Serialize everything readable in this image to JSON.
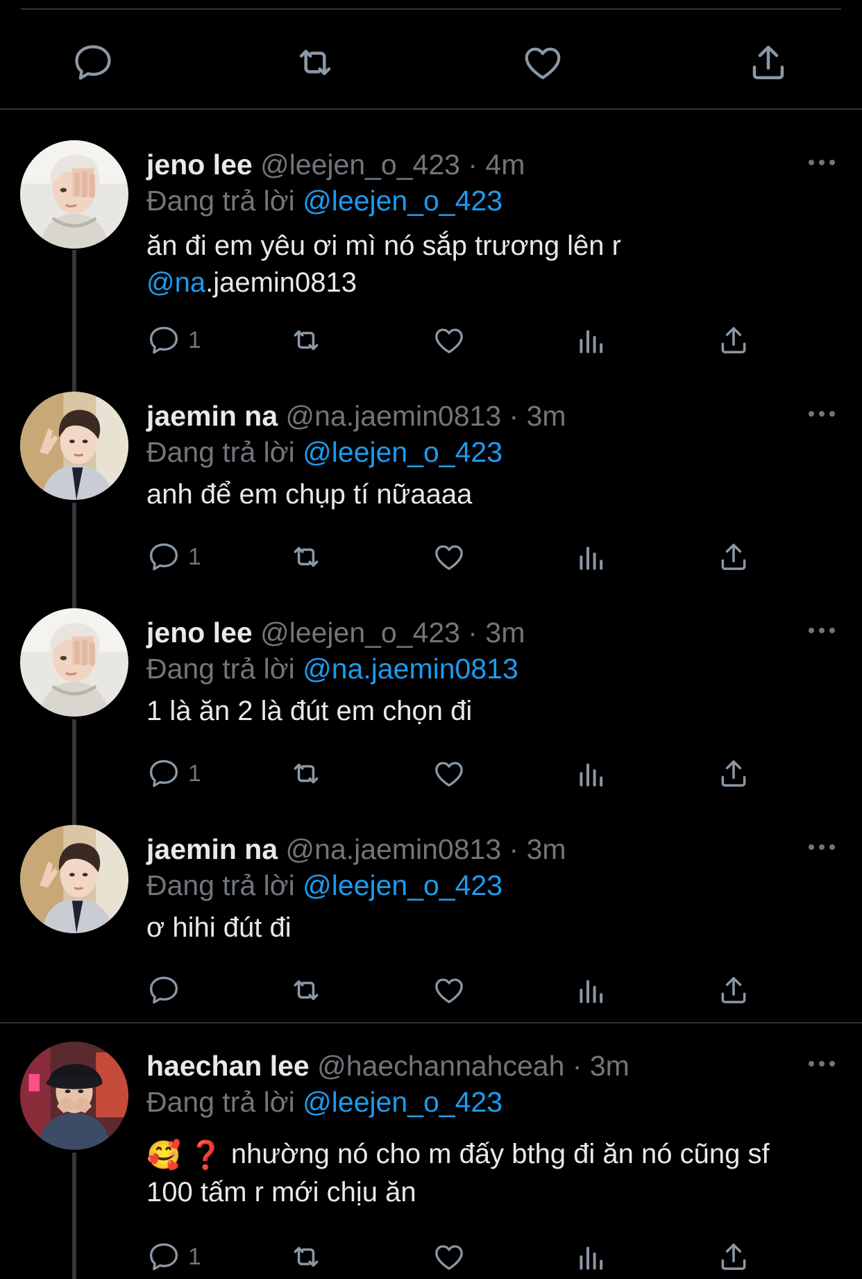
{
  "reply_label": "Đang trả lời",
  "tweets": [
    {
      "name": "jeno lee",
      "handle": "@leejen_o_423",
      "sep": "·",
      "time": "4m",
      "reply_to": "@leejen_o_423",
      "body_line1": "ăn đi em yêu ơi mì nó sắp trương lên r",
      "body_mention": "@na",
      "body_rest": ".jaemin0813",
      "reply_count": "1"
    },
    {
      "name": "jaemin na",
      "handle": "@na.jaemin0813",
      "sep": "·",
      "time": "3m",
      "reply_to": "@leejen_o_423",
      "body": "anh để em chụp tí nữaaaa",
      "reply_count": "1"
    },
    {
      "name": "jeno lee",
      "handle": "@leejen_o_423",
      "sep": "·",
      "time": "3m",
      "reply_to": "@na.jaemin0813",
      "body": "1 là ăn 2 là đút em chọn đi",
      "reply_count": "1"
    },
    {
      "name": "jaemin na",
      "handle": "@na.jaemin0813",
      "sep": "·",
      "time": "3m",
      "reply_to": "@leejen_o_423",
      "body": "ơ hihi đút đi",
      "reply_count": ""
    },
    {
      "name": "haechan lee",
      "handle": "@haechannahceah",
      "sep": "·",
      "time": "3m",
      "reply_to": "@leejen_o_423",
      "body_emoji": "🥰 ❓",
      "body_line1": "nhường nó cho m đấy bthg đi ăn nó cũng sf",
      "body_line2": "100 tấm r mới chịu ăn",
      "reply_count": "1"
    }
  ],
  "icons": {
    "reply": "reply-icon",
    "retweet": "retweet-icon",
    "like": "heart-icon",
    "views": "views-icon",
    "share": "share-icon",
    "more": "more-icon"
  },
  "colors": {
    "background": "#000000",
    "accent": "#1d9bf0",
    "muted": "#71767b",
    "text": "#e7e9ea"
  }
}
